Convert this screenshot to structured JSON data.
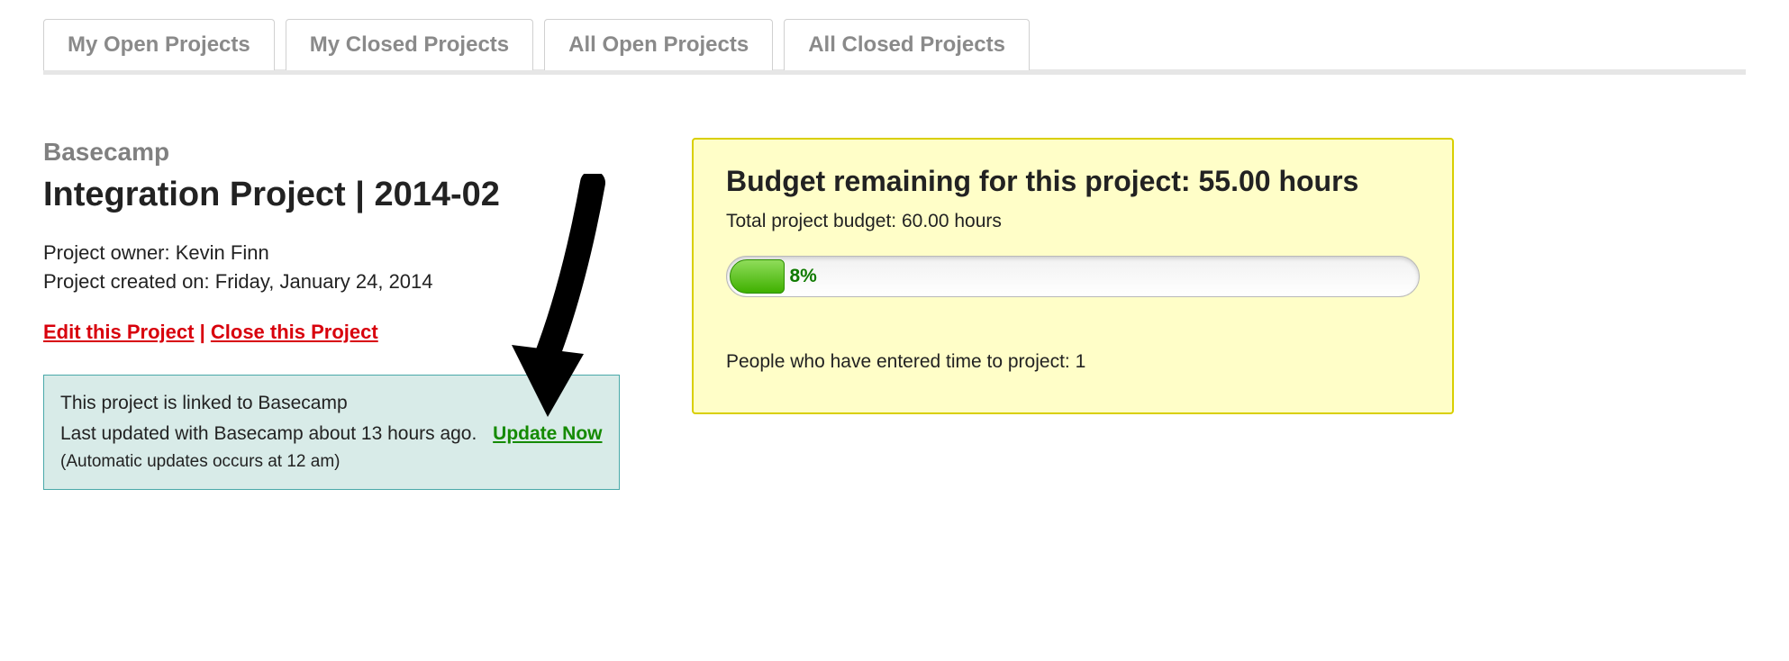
{
  "tabs": {
    "my_open": "My Open Projects",
    "my_closed": "My Closed Projects",
    "all_open": "All Open Projects",
    "all_closed": "All Closed Projects"
  },
  "project": {
    "account_name": "Basecamp",
    "title": "Integration Project | 2014-02",
    "owner_label": "Project owner: ",
    "owner_name": "Kevin Finn",
    "created_label": "Project created on: ",
    "created_date": "Friday, January 24, 2014"
  },
  "actions": {
    "edit": "Edit this Project",
    "sep": " | ",
    "close": "Close this Project"
  },
  "basecamp_box": {
    "linked_line": "This project is linked to Basecamp",
    "last_updated": "Last updated with Basecamp about 13 hours ago.",
    "update_now": "Update Now",
    "auto_note": "(Automatic updates occurs at 12 am)"
  },
  "budget": {
    "heading_prefix": "Budget remaining for this project: ",
    "remaining_hours": "55.00 hours",
    "total_label": "Total project budget: ",
    "total_hours": "60.00 hours",
    "percent_used": 8,
    "percent_label": "8%",
    "people_label": "People who have entered time to project: ",
    "people_count": "1"
  }
}
